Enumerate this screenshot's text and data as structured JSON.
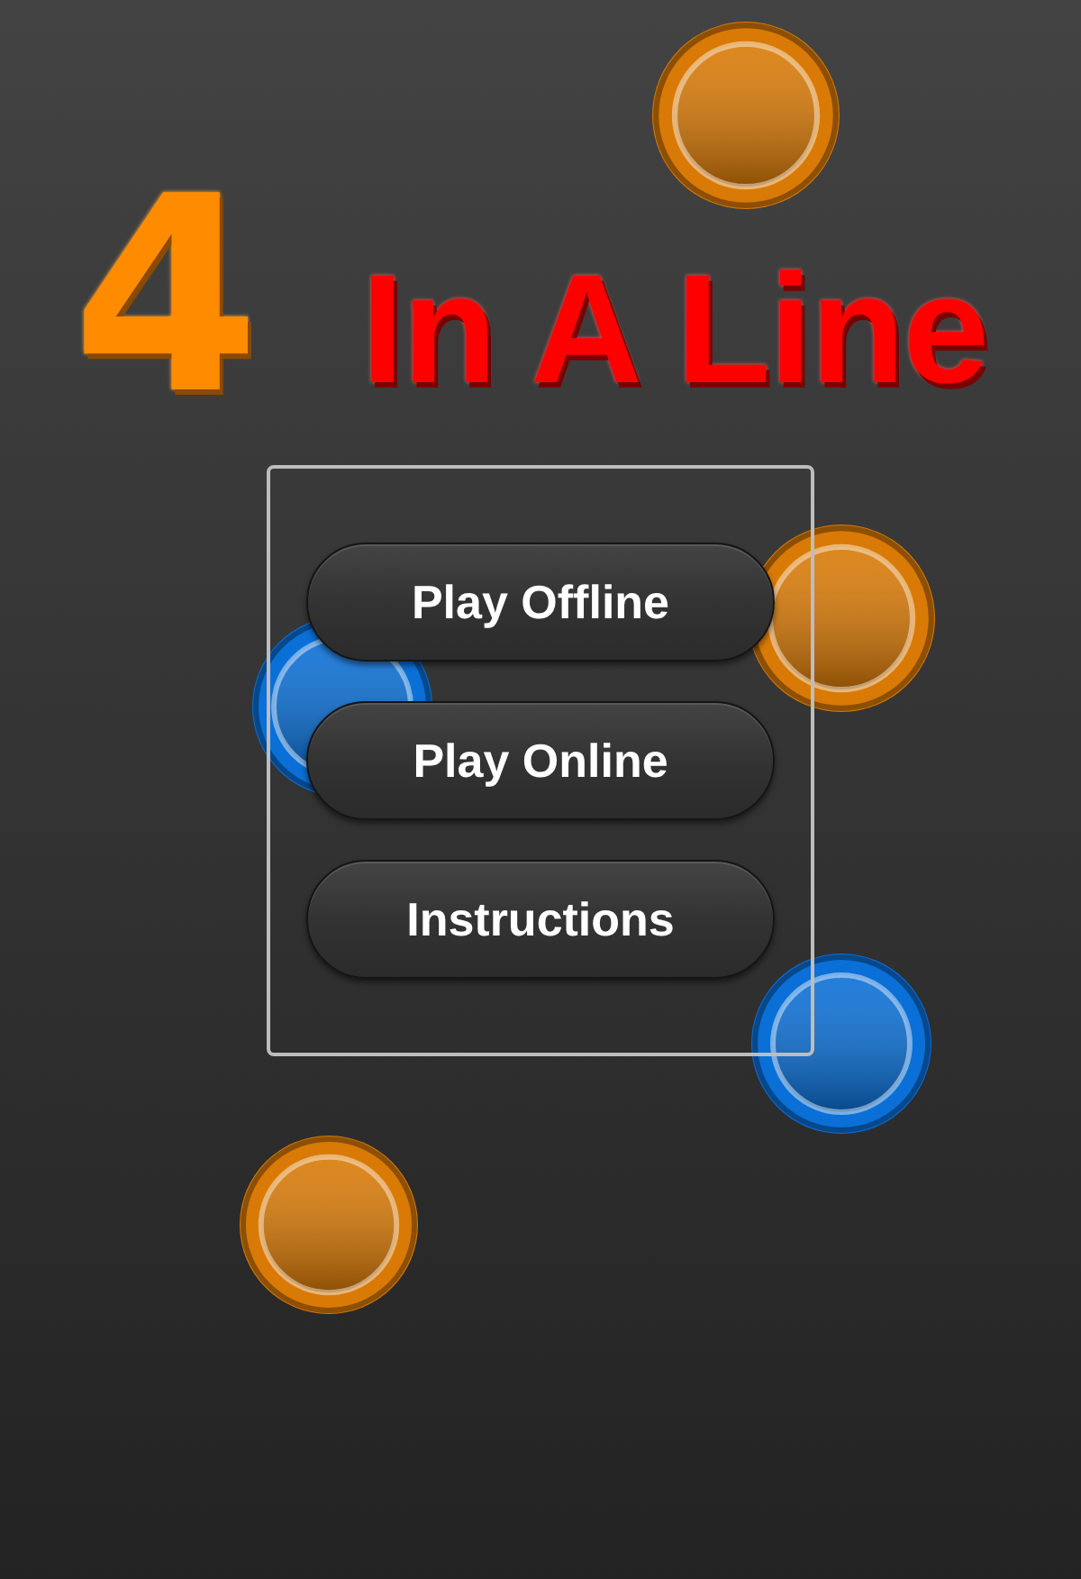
{
  "title": {
    "number": "4",
    "text": "In A Line"
  },
  "menu": {
    "buttons": [
      "Play Offline",
      "Play Online",
      "Instructions"
    ]
  },
  "discs": [
    {
      "color": "#d97a06"
    },
    {
      "color": "#d97a06"
    },
    {
      "color": "#0a6fd6"
    },
    {
      "color": "#0a6fd6"
    },
    {
      "color": "#d97a06"
    }
  ]
}
